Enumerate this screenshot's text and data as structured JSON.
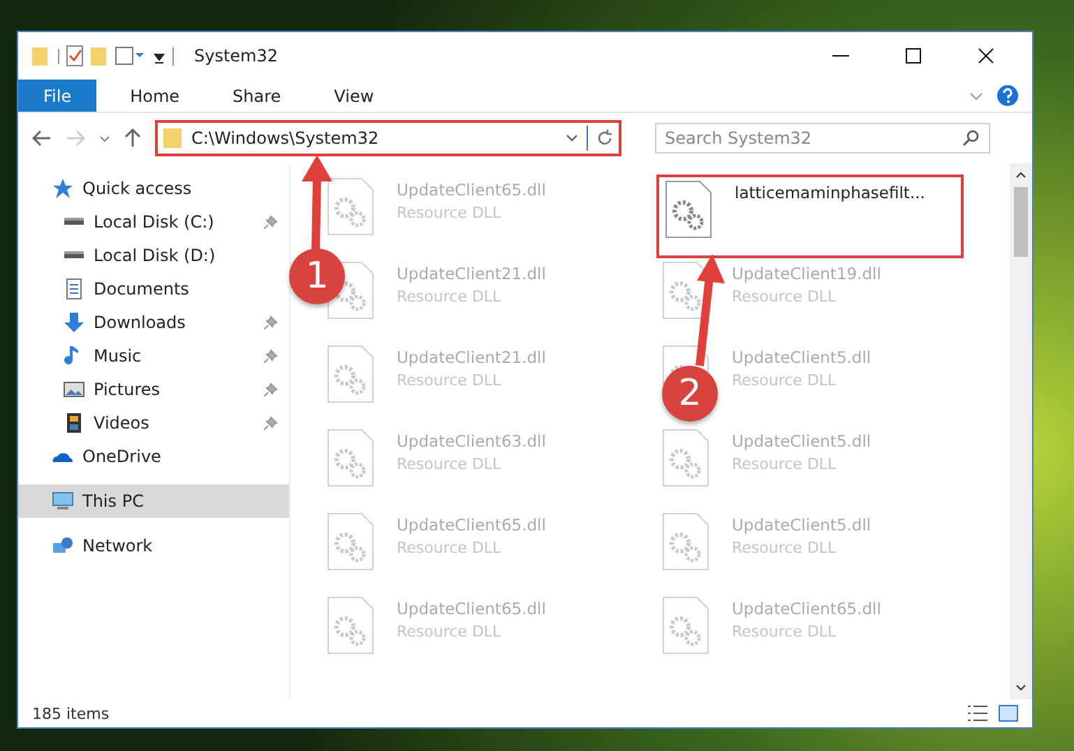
{
  "window": {
    "title": "System32"
  },
  "ribbon_tabs": [
    {
      "label": "File",
      "selected": true
    },
    {
      "label": "Home",
      "selected": false
    },
    {
      "label": "Share",
      "selected": false
    },
    {
      "label": "View",
      "selected": false
    }
  ],
  "address_bar": {
    "path": "C:\\Windows\\System32"
  },
  "search": {
    "placeholder": "Search System32"
  },
  "sidebar": {
    "items": [
      {
        "label": "Quick access",
        "kind": "star",
        "pinned": false,
        "selected": false,
        "children": [
          {
            "label": "Local Disk (C:)",
            "kind": "drive",
            "pinned": true,
            "selected": false
          },
          {
            "label": "Local Disk (D:)",
            "kind": "drive",
            "pinned": false,
            "selected": false
          },
          {
            "label": "Documents",
            "kind": "documents",
            "pinned": false,
            "selected": false
          },
          {
            "label": "Downloads",
            "kind": "download",
            "pinned": true,
            "selected": false
          },
          {
            "label": "Music",
            "kind": "music",
            "pinned": true,
            "selected": false
          },
          {
            "label": "Pictures",
            "kind": "pictures",
            "pinned": true,
            "selected": false
          },
          {
            "label": "Videos",
            "kind": "videos",
            "pinned": true,
            "selected": false
          }
        ]
      },
      {
        "label": "OneDrive",
        "kind": "cloud",
        "pinned": false,
        "selected": false
      },
      {
        "label": "This PC",
        "kind": "pc",
        "pinned": false,
        "selected": true
      },
      {
        "label": "Network",
        "kind": "network",
        "pinned": false,
        "selected": false
      }
    ]
  },
  "files": [
    {
      "name": "UpdateClient65.dll",
      "type": "Resource DLL",
      "highlighted": false
    },
    {
      "name": "latticemaminphasefilt...",
      "highlighted": true
    },
    {
      "name": "UpdateClient21.dll",
      "type": "Resource DLL",
      "highlighted": false
    },
    {
      "name": "UpdateClient19.dll",
      "type": "Resource DLL",
      "highlighted": false
    },
    {
      "name": "UpdateClient21.dll",
      "type": "Resource DLL",
      "highlighted": false
    },
    {
      "name": "UpdateClient5.dll",
      "type": "Resource DLL",
      "highlighted": false
    },
    {
      "name": "UpdateClient63.dll",
      "type": "Resource DLL",
      "highlighted": false
    },
    {
      "name": "UpdateClient5.dll",
      "type": "Resource DLL",
      "highlighted": false
    },
    {
      "name": "UpdateClient65.dll",
      "type": "Resource DLL",
      "highlighted": false
    },
    {
      "name": "UpdateClient5.dll",
      "type": "Resource DLL",
      "highlighted": false
    },
    {
      "name": "UpdateClient65.dll",
      "type": "Resource DLL",
      "highlighted": false
    },
    {
      "name": "UpdateClient65.dll",
      "type": "Resource DLL",
      "highlighted": false
    }
  ],
  "status_bar": {
    "count": "185 items"
  },
  "annotations": [
    {
      "number": "1"
    },
    {
      "number": "2"
    }
  ]
}
